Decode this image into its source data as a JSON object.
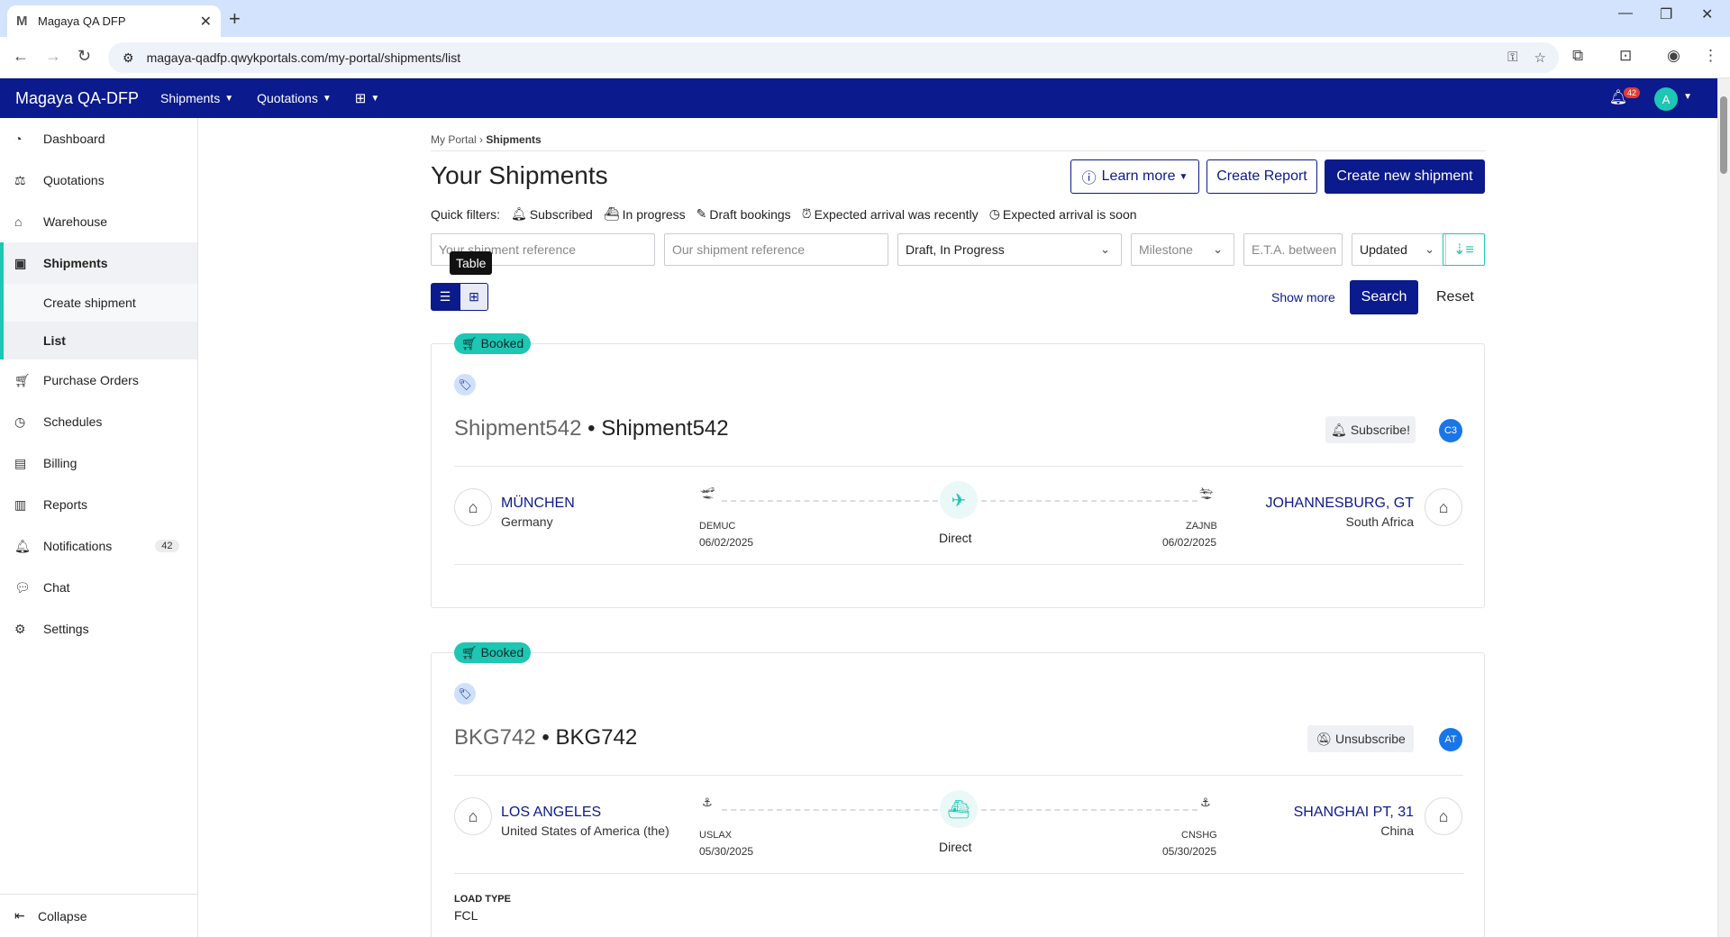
{
  "browser": {
    "tab_title": "Magaya QA DFP",
    "tab_favicon": "M",
    "url": "magaya-qadfp.qwykportals.com/my-portal/shipments/list"
  },
  "header": {
    "brand": "Magaya QA-DFP",
    "menus": [
      "Shipments",
      "Quotations"
    ],
    "notif_count": "42",
    "avatar": "A"
  },
  "sidebar": {
    "items": [
      {
        "label": "Dashboard",
        "icon": "dashboard-icon"
      },
      {
        "label": "Quotations",
        "icon": "quotations-icon"
      },
      {
        "label": "Warehouse",
        "icon": "warehouse-icon"
      },
      {
        "label": "Shipments",
        "icon": "shipments-icon"
      },
      {
        "label": "Purchase Orders",
        "icon": "cart-icon"
      },
      {
        "label": "Schedules",
        "icon": "clock-icon"
      },
      {
        "label": "Billing",
        "icon": "billing-icon"
      },
      {
        "label": "Reports",
        "icon": "chart-icon"
      },
      {
        "label": "Notifications",
        "icon": "bell-icon",
        "count": "42"
      },
      {
        "label": "Chat",
        "icon": "chat-icon"
      },
      {
        "label": "Settings",
        "icon": "gear-icon"
      }
    ],
    "sub": [
      "Create shipment",
      "List"
    ],
    "collapse": "Collapse"
  },
  "main": {
    "breadcrumb_root": "My Portal",
    "breadcrumb_sep": "›",
    "breadcrumb_current": "Shipments",
    "title": "Your Shipments",
    "learn_more": "Learn more",
    "create_report": "Create Report",
    "create_new": "Create new shipment",
    "quick_filters_label": "Quick filters:",
    "quick_filters": [
      "Subscribed",
      "In progress",
      "Draft bookings",
      "Expected arrival was recently",
      "Expected arrival is soon"
    ],
    "filters": {
      "your_ref_placeholder": "Your shipment reference",
      "our_ref_placeholder": "Our shipment reference",
      "status_value": "Draft, In Progress",
      "milestone_placeholder": "Milestone",
      "eta_placeholder": "E.T.A. between",
      "sort_value": "Updated"
    },
    "tooltip": "Table",
    "show_more": "Show more",
    "search": "Search",
    "reset": "Reset"
  },
  "shipments": [
    {
      "status": "Booked",
      "ref": "Shipment542",
      "name": "Shipment542",
      "subscribe_label": "Subscribe!",
      "initials": "C3",
      "origin_city": "MÜNCHEN",
      "origin_country": "Germany",
      "origin_code": "DEMUC",
      "origin_date": "06/02/2025",
      "mode_icon": "airplane-icon",
      "route": "Direct",
      "dest_code": "ZAJNB",
      "dest_date": "06/02/2025",
      "dest_city": "JOHANNESBURG, GT",
      "dest_country": "South Africa"
    },
    {
      "status": "Booked",
      "ref": "BKG742",
      "name": "BKG742",
      "subscribe_label": "Unsubscribe",
      "initials": "AT",
      "origin_city": "LOS ANGELES",
      "origin_country": "United States of America (the)",
      "origin_code": "USLAX",
      "origin_date": "05/30/2025",
      "mode_icon": "ship-icon",
      "route": "Direct",
      "dest_code": "CNSHG",
      "dest_date": "05/30/2025",
      "dest_city": "SHANGHAI PT, 31",
      "dest_country": "China",
      "load_type_label": "LOAD TYPE",
      "load_type": "FCL"
    }
  ],
  "colors": {
    "brand": "#0b1a8c",
    "accent": "#1ec6b4",
    "badge": "#e53935"
  }
}
